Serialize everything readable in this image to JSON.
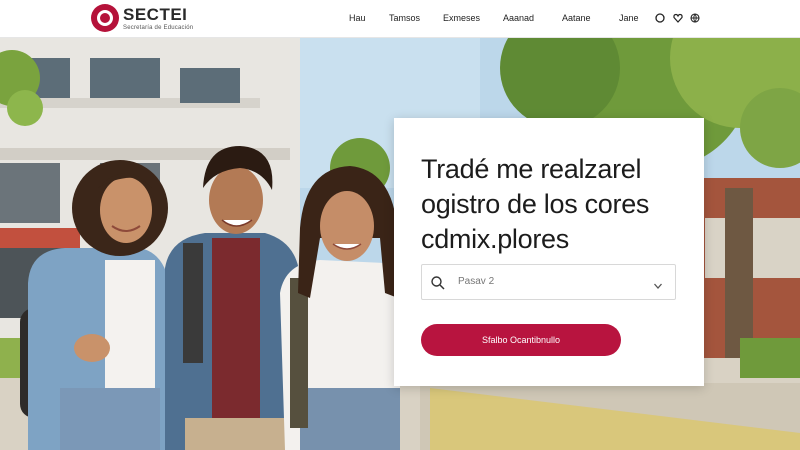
{
  "brand": {
    "name": "SECTEI",
    "subtitle": "Secretaría de Educación",
    "color": "#b5123a"
  },
  "nav": {
    "items": [
      "Hau",
      "Tamsos",
      "Exmeses",
      "Aaanad",
      "Aatane",
      "Jane"
    ],
    "icons": [
      "info-icon",
      "heart-icon",
      "globe-icon"
    ]
  },
  "card": {
    "title_lines": [
      "Tradé me realzarel",
      "ogistro de los cores",
      "cdmix.plores"
    ],
    "select": {
      "value": "Pasav 2"
    },
    "cta_label": "Sfalbo Ocantibnullo",
    "accent": "#b8143f"
  }
}
